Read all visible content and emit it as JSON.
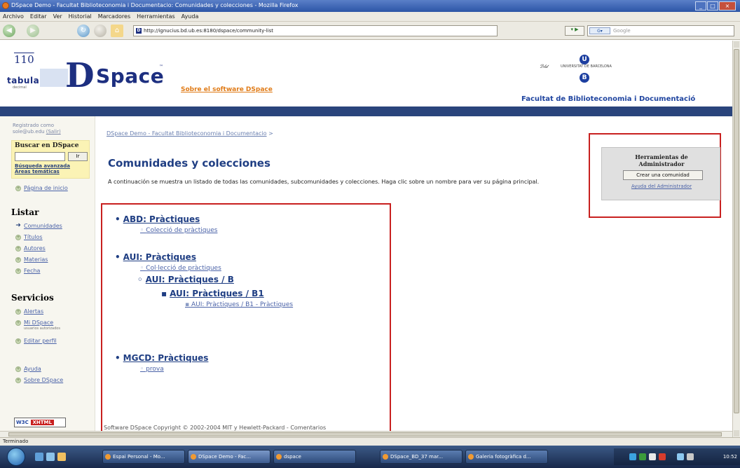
{
  "window": {
    "title": "DSpace Demo - Facultat Biblioteconomia i Documentacio: Comunidades y colecciones - Mozilla Firefox"
  },
  "menubar": [
    "Archivo",
    "Editar",
    "Ver",
    "Historial",
    "Marcadores",
    "Herramientas",
    "Ayuda"
  ],
  "navbar": {
    "url": "http://ignucius.bd.ub.es:8180/dspace/community-list",
    "search_placeholder": "Google"
  },
  "header": {
    "tabula_number": "110",
    "tabula_word": "tabula",
    "tabula_sub": "decimal",
    "dspace_word": "Space",
    "dspace_letter": "D",
    "about_link": "Sobre el software DSpace",
    "university": "UNIVERSITAT DE BARCELONA",
    "faculty": "Facultat de Biblioteconomia i Documentació",
    "colors": {
      "brand": "#1f3e83",
      "bar": "#2a447c",
      "accent": "#e07b17",
      "highlight": "#c8201f"
    }
  },
  "sidebar": {
    "logged_in": "Registrado como",
    "user": "sole@ub.edu",
    "logout": "(Salir)",
    "search_heading": "Buscar en DSpace",
    "go_label": "Ir",
    "advanced_search": "Búsqueda avanzada",
    "topic_areas": "Áreas temáticas",
    "home": "Página de inicio",
    "browse_heading": "Listar",
    "browse_items": [
      "Comunidades",
      "Títulos",
      "Autores",
      "Materias",
      "Fecha"
    ],
    "services_heading": "Servicios",
    "alerts": "Alertas",
    "my_dspace": "Mi DSpace",
    "my_dspace_sub": "usuarios autorizados",
    "edit_profile": "Editar perfil",
    "help": "Ayuda",
    "about": "Sobre DSpace"
  },
  "main": {
    "breadcrumb": "DSpace Demo - Facultat Biblioteconomia i Documentacio",
    "breadcrumb_sep": ">",
    "title": "Comunidades y colecciones",
    "intro": "A continuación se muestra un listado de todas las comunidades, subcomunidades y colecciones. Haga clic sobre un nombre para ver su página principal.",
    "communities": [
      {
        "name": "ABD: Pràctiques",
        "collections": [
          "Colecció de pràctiques"
        ]
      },
      {
        "name": "AUI: Pràctiques",
        "collections": [
          "Col·lecció de pràctiques"
        ],
        "sub": {
          "name": "AUI: Pràctiques / B",
          "sub": {
            "name": "AUI: Pràctiques / B1",
            "collections": [
              "AUI: Pràctiques / B1 - Pràctiques"
            ]
          }
        }
      },
      {
        "name": "MGCD: Pràctiques",
        "collections": [
          "prova"
        ]
      }
    ]
  },
  "admin": {
    "title_line1": "Herramientas de",
    "title_line2": "Administrador",
    "create_button": "Crear una comunidad",
    "help_link": "Ayuda del Administrador"
  },
  "footer": {
    "text": "Software DSpace   Copyright © 2002-2004   MIT  y  Hewlett-Packard  -  Comentarios",
    "badge_w3c": "W3C",
    "badge_xhtml": "XHTML"
  },
  "status": "Terminado",
  "taskbar": {
    "tasks": [
      "Espai Personal - Mo...",
      "DSpace Demo - Fac...",
      "dspace",
      "DSpace_BD_37 mar...",
      "Galeria fotogràfica d..."
    ],
    "clock": "10:52"
  }
}
